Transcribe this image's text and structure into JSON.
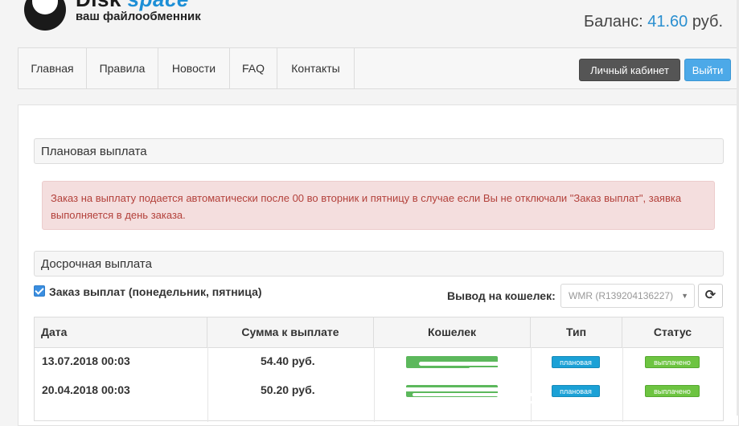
{
  "header": {
    "logo_title_1": "Disk",
    "logo_title_2": "space",
    "logo_subtitle": "ваш файлообменник",
    "balance_label": "Баланс:",
    "balance_amount": "41.60",
    "balance_currency": "руб."
  },
  "nav": {
    "items": [
      {
        "label": "Главная"
      },
      {
        "label": "Правила"
      },
      {
        "label": "Новости"
      },
      {
        "label": "FAQ"
      },
      {
        "label": "Контакты"
      }
    ],
    "cabinet_label": "Личный кабинет",
    "logout_label": "Выйти"
  },
  "planned": {
    "heading": "Плановая выплата",
    "alert_text": "Заказ на выплату подается автоматически после 00 во вторник и пятницу в случае если Вы не отключали \"Заказ выплат\", заявка выполняется в день заказа."
  },
  "early": {
    "heading": "Досрочная выплата",
    "checkbox_label": "Заказ выплат (понедельник, пятница)",
    "checkbox_checked": true,
    "wallet_label": "Вывод на кошелек:",
    "wallet_value": "WMR (R139204136227)"
  },
  "table": {
    "columns": [
      "Дата",
      "Сумма к выплате",
      "Кошелек",
      "Тип",
      "Статус"
    ],
    "rows": [
      {
        "date": "13.07.2018 00:03",
        "amount": "54.40 руб.",
        "type": "плановая",
        "status": "выплачено"
      },
      {
        "date": "20.04.2018 00:03",
        "amount": "50.20 руб.",
        "type": "плановая",
        "status": "выплачено"
      }
    ]
  },
  "icons": {
    "refresh": "refresh-icon",
    "caret": "caret-down-icon",
    "logo": "cloud-logo-icon"
  },
  "colors": {
    "accent": "#2a8fd0",
    "alert_text": "#b3413b",
    "type_badge": "#1ba1d6",
    "status_badge": "#6dc441"
  }
}
